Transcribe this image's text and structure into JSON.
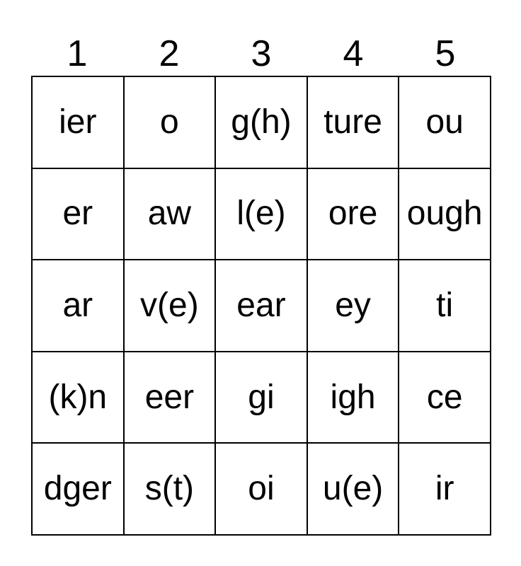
{
  "card": {
    "type": "bingo-card",
    "columns": 5,
    "rows": 5,
    "colors": {
      "background": "#ffffff",
      "border": "#000000",
      "text": "#000000"
    },
    "column_headers": [
      "1",
      "2",
      "3",
      "4",
      "5"
    ],
    "grid": [
      [
        "ier",
        "o",
        "g(h)",
        "ture",
        "ou"
      ],
      [
        "er",
        "aw",
        "l(e)",
        "ore",
        "ough"
      ],
      [
        "ar",
        "v(e)",
        "ear",
        "ey",
        "ti"
      ],
      [
        "(k)n",
        "eer",
        "gi",
        "igh",
        "ce"
      ],
      [
        "dger",
        "s(t)",
        "oi",
        "u(e)",
        "ir"
      ]
    ]
  }
}
